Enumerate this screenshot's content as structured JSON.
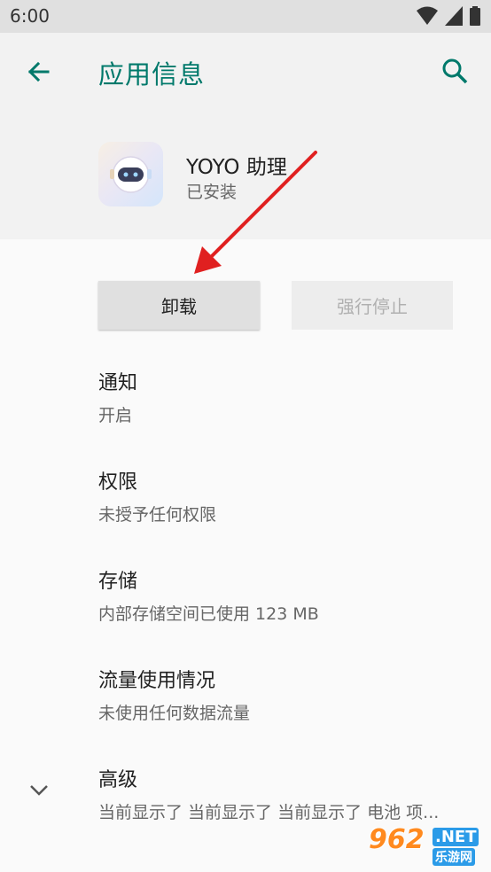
{
  "status_bar": {
    "time": "6:00"
  },
  "header": {
    "title": "应用信息"
  },
  "app": {
    "name": "YOYO 助理",
    "status": "已安装"
  },
  "actions": {
    "uninstall": "卸载",
    "force_stop": "强行停止"
  },
  "settings": [
    {
      "title": "通知",
      "subtitle": "开启"
    },
    {
      "title": "权限",
      "subtitle": "未授予任何权限"
    },
    {
      "title": "存储",
      "subtitle": "内部存储空间已使用 123 MB"
    },
    {
      "title": "流量使用情况",
      "subtitle": "未使用任何数据流量"
    },
    {
      "title": "高级",
      "subtitle": "当前显示了 当前显示了 当前显示了 电池 项..."
    }
  ],
  "watermark": {
    "number": "962",
    "domain": ".NET",
    "label": "乐游网"
  },
  "colors": {
    "accent": "#00796b",
    "arrow": "#e02020"
  }
}
